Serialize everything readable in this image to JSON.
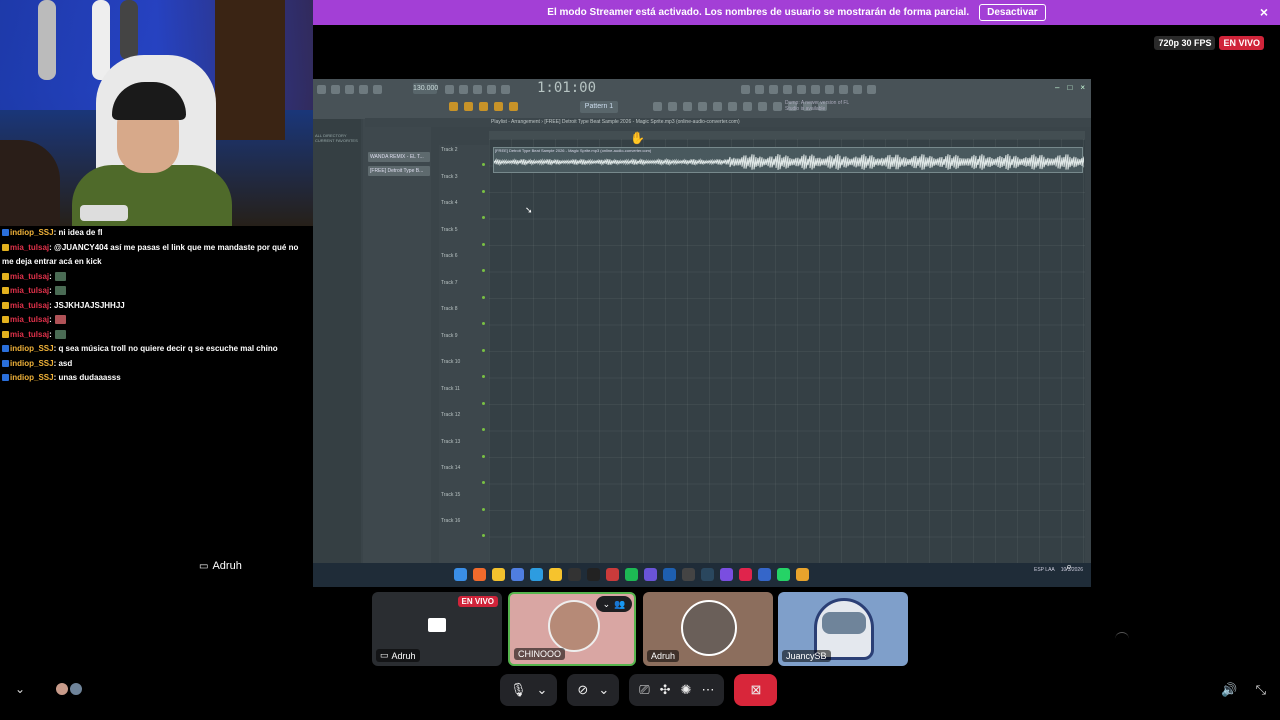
{
  "banner": {
    "text": "El modo Streamer está activado. Los nombres de usuario se mostrarán de forma parcial.",
    "button": "Desactivar",
    "close_icon": "×"
  },
  "stream": {
    "quality": "720p 30 FPS",
    "live": "EN VIVO"
  },
  "chat": [
    {
      "user": "indiop_SSJ",
      "color": "#f2b43a",
      "text": ": ni idea de fl",
      "badge": "blue"
    },
    {
      "user": "mia_tulsaj",
      "color": "#e0314a",
      "text": ": @JUANCY404 así me pasas el link que me mandaste por qué no me deja entrar acá en kick",
      "badge": "yellow"
    },
    {
      "user": "mia_tulsaj",
      "color": "#e0314a",
      "text": ":",
      "badge": "yellow",
      "emote": "#4a6b54"
    },
    {
      "user": "mia_tulsaj",
      "color": "#e0314a",
      "text": ":",
      "badge": "yellow",
      "emote": "#4a6b54"
    },
    {
      "user": "mia_tulsaj",
      "color": "#e0314a",
      "text": ": JSJKHJAJSJHHJJ",
      "badge": "yellow"
    },
    {
      "user": "mia_tulsaj",
      "color": "#e0314a",
      "text": ":",
      "badge": "yellow",
      "emote": "#b05257"
    },
    {
      "user": "mia_tulsaj",
      "color": "#e0314a",
      "text": ":",
      "badge": "yellow",
      "emote": "#4a6b54"
    },
    {
      "user": "indiop_SSJ",
      "color": "#f2b43a",
      "text": ": q sea música troll no quiere decir q se escuche mal chino",
      "badge": "blue"
    },
    {
      "user": "indiop_SSJ",
      "color": "#f2b43a",
      "text": ": asd",
      "badge": "blue"
    },
    {
      "user": "indiop_SSJ",
      "color": "#f2b43a",
      "text": ": unas dudaaasss",
      "badge": "blue"
    }
  ],
  "fl": {
    "bpm": "130.000",
    "time": "1:01:00",
    "pattern": "Pattern 1",
    "hint": "Dump: A newer version of FL Studio is available",
    "playlist_title": "Playlist - Arrangement › [FREE] Detroit Type Beat Sample 2026 - Magic Sprite.mp3 (online-audio-converter.com)",
    "clip_title": "[FREE] Detroit Type Beat Sample 2026 - Magic Sprite.mp3 (online-audio-converter.com)",
    "browser_tabs": "ALL   DIRECTORY   CURRENT   FAVORITES",
    "channels": [
      "WANDA REMIX - EL T...",
      "[FREE] Detroit Type B..."
    ],
    "tracks": [
      "Track 2",
      "Track 3",
      "Track 4",
      "Track 5",
      "Track 6",
      "Track 7",
      "Track 8",
      "Track 9",
      "Track 10",
      "Track 11",
      "Track 12",
      "Track 13",
      "Track 14",
      "Track 15",
      "Track 16"
    ],
    "tray": [
      "ESP LAA",
      "10/3/2026"
    ]
  },
  "screen_share": {
    "owner": "Adruh"
  },
  "participants": [
    {
      "name": "Adruh",
      "live": "EN VIVO"
    },
    {
      "name": "CHINOOO"
    },
    {
      "name": "Adruh"
    },
    {
      "name": "JuancySB"
    }
  ],
  "icons": {
    "mic": "microphone-icon",
    "video_off": "video-off-icon",
    "screen_share": "screen-share-icon",
    "activities": "activities-icon",
    "soundboard": "soundboard-icon",
    "more": "more-icon",
    "end_call": "end-call-icon",
    "volume": "volume-icon",
    "fullscreen": "exit-fullscreen-icon"
  }
}
